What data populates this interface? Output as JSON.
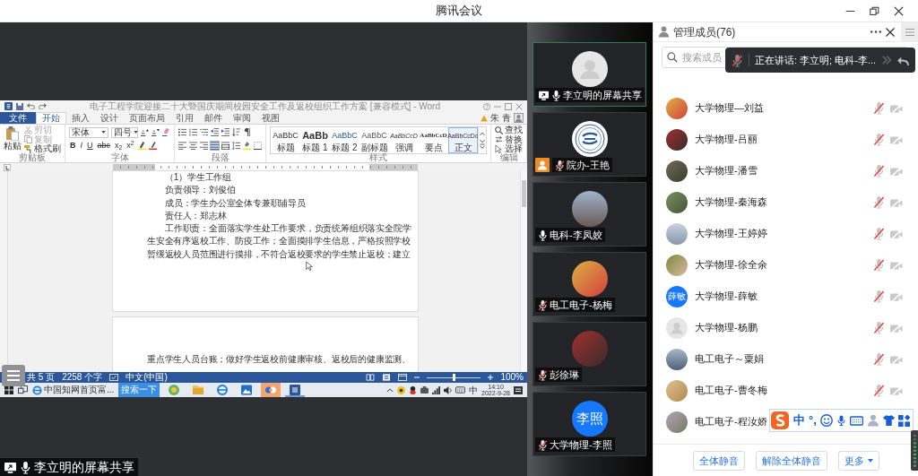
{
  "window": {
    "title": "腾讯会议"
  },
  "shared_screen": {
    "sharer": {
      "name": "李立明的屏幕共享",
      "muted": false
    },
    "word": {
      "title": "电子工程学院迎接二十大暨国庆期间校园安全工作及返校组织工作方案 [兼容模式] - Word",
      "tabs": [
        {
          "label": "文件",
          "kind": "file",
          "selected": false
        },
        {
          "label": "开始",
          "kind": "tab",
          "selected": true
        },
        {
          "label": "插入",
          "kind": "tab",
          "selected": false
        },
        {
          "label": "设计",
          "kind": "tab",
          "selected": false
        },
        {
          "label": "页面布局",
          "kind": "tab",
          "selected": false
        },
        {
          "label": "引用",
          "kind": "tab",
          "selected": false
        },
        {
          "label": "邮件",
          "kind": "tab",
          "selected": false
        },
        {
          "label": "审阅",
          "kind": "tab",
          "selected": false
        },
        {
          "label": "视图",
          "kind": "tab",
          "selected": false
        }
      ],
      "account": "朱 青",
      "ribbon": {
        "clipboard": {
          "paste": "粘贴",
          "items": [
            {
              "label": "剪切",
              "kind": "cut",
              "disabled": true
            },
            {
              "label": "复制",
              "kind": "copy",
              "disabled": true
            },
            {
              "label": "格式刷",
              "kind": "format_painter",
              "disabled": false
            }
          ],
          "label": "剪贴板"
        },
        "font": {
          "face": "宋体",
          "size": "四号",
          "format": [
            {
              "label": "B",
              "kind": "bold"
            },
            {
              "label": "I",
              "kind": "italic"
            },
            {
              "label": "U",
              "kind": "underline"
            },
            {
              "label": "abc",
              "kind": "strikethrough"
            },
            {
              "label": "x$_{2}$",
              "kind": "subscript"
            },
            {
              "label": "x$^{2}$",
              "kind": "superscript"
            }
          ],
          "label": "字体"
        },
        "paragraph": {
          "alignments": [
            {
              "kind": "left",
              "selected": false
            },
            {
              "kind": "center",
              "selected": false
            },
            {
              "kind": "right",
              "selected": false
            },
            {
              "kind": "justify",
              "selected": true
            },
            {
              "kind": "distributed",
              "selected": false
            }
          ],
          "label": "段落"
        },
        "styles": {
          "items": [
            {
              "sample": "AaBbC",
              "name": "标题",
              "kind": "title",
              "selected": false
            },
            {
              "sample": "AaBb",
              "name": "标题 1",
              "kind": "heading1",
              "selected": false
            },
            {
              "sample": "AaBbC",
              "name": "标题 2",
              "kind": "heading2",
              "selected": false
            },
            {
              "sample": "AaBbC",
              "name": "副标题",
              "kind": "subtitle",
              "selected": false
            },
            {
              "sample": "AaBbCcD",
              "name": "强调",
              "kind": "emphasis",
              "selected": false
            },
            {
              "sample": "AaBbCcD",
              "name": "要点",
              "kind": "strong",
              "selected": false
            },
            {
              "sample": "AaBbCcDd",
              "name": "正文",
              "kind": "normal",
              "selected": true
            }
          ],
          "label": "样式"
        },
        "editing": {
          "items": [
            {
              "label": "查找",
              "kind": "find"
            },
            {
              "label": "替换",
              "kind": "replace"
            },
            {
              "label": "选择",
              "kind": "select"
            }
          ],
          "label": "编辑"
        }
      },
      "pages": [
        {
          "lines": [
            {
              "text": "（1）学生工作组",
              "indent": true
            },
            {
              "text": "负责领导：刘俊伯",
              "indent": true
            },
            {
              "text": "成员：学生办公室全体专兼职辅导员",
              "indent": true
            },
            {
              "text": "责任人：郑志林",
              "indent": true
            },
            {
              "text": "工作职责：全面落实学生处工作要求，负责统筹组织落实全院学",
              "indent": true
            },
            {
              "text": "生安全有序返校工作、防疫工作；全面摸排学生信息，严格按照学校",
              "indent": false
            },
            {
              "text": "暂缓返校人员范围进行摸排，不符合返校要求的学生禁止返校；建立",
              "indent": false
            }
          ]
        },
        {
          "lines": [
            {
              "text": "重点学生人员台账；做好学生返校前健康审核、返校后的健康监测、",
              "indent": false
            }
          ]
        }
      ],
      "status_bar": {
        "pages": "共 5 页",
        "words": "2258 个字",
        "language": "中文(中国)",
        "zoom_slider": {
          "level": 0.5
        },
        "zoom": "100%"
      }
    },
    "taskbar": {
      "window": "中国知网首页富...",
      "search": "搜索一下",
      "apps": [
        {
          "kind": "browser",
          "active": false,
          "running": false
        },
        {
          "kind": "folder",
          "active": false,
          "running": false
        },
        {
          "kind": "ie",
          "active": false,
          "running": false
        },
        {
          "kind": "photos",
          "active": false,
          "running": false
        },
        {
          "kind": "meeting",
          "active": true,
          "running": false
        },
        {
          "kind": "word",
          "active": false,
          "running": true
        }
      ],
      "ime": "中",
      "time": "14:10",
      "date": "2022-9-28"
    }
  },
  "video_tiles": [
    {
      "name": "李立明的屏幕共享",
      "avatar": {
        "kind": "silhouette"
      },
      "speaking": true,
      "sharing": true,
      "host": false,
      "muted": false
    },
    {
      "name": "院办-王艳",
      "avatar": {
        "kind": "emblem"
      },
      "speaking": false,
      "sharing": false,
      "host": true,
      "muted": true
    },
    {
      "name": "电科-李凤姣",
      "avatar": {
        "kind": "photo"
      },
      "speaking": false,
      "sharing": false,
      "host": false,
      "muted": false
    },
    {
      "name": "电工电子-杨梅",
      "avatar": {
        "kind": "photo"
      },
      "speaking": false,
      "sharing": false,
      "host": false,
      "muted": true
    },
    {
      "name": "彭徐琳",
      "avatar": {
        "kind": "photo"
      },
      "speaking": false,
      "sharing": false,
      "host": false,
      "muted": true
    },
    {
      "name": "大学物理-李照",
      "avatar": {
        "kind": "initials",
        "text": "李照"
      },
      "speaking": false,
      "sharing": false,
      "host": false,
      "muted": true
    }
  ],
  "members": {
    "title": "管理成员(76)",
    "search": {
      "placeholder": "搜索成员"
    },
    "speaking_tip": "正在讲话: 李立明; 电科-李...",
    "rows": [
      {
        "name": "大学物理—刘益",
        "avatar": {
          "kind": "photo"
        },
        "mic_muted": true,
        "camera_off": true
      },
      {
        "name": "大学物理-吕丽",
        "avatar": {
          "kind": "photo"
        },
        "mic_muted": true,
        "camera_off": true
      },
      {
        "name": "大学物理-潘雪",
        "avatar": {
          "kind": "photo"
        },
        "mic_muted": true,
        "camera_off": true
      },
      {
        "name": "大学物理-秦海森",
        "avatar": {
          "kind": "photo"
        },
        "mic_muted": true,
        "camera_off": true
      },
      {
        "name": "大学物理-王婷婷",
        "avatar": {
          "kind": "photo"
        },
        "mic_muted": true,
        "camera_off": true
      },
      {
        "name": "大学物理-徐全余",
        "avatar": {
          "kind": "photo"
        },
        "mic_muted": true,
        "camera_off": true
      },
      {
        "name": "大学物理-薛敏",
        "avatar": {
          "kind": "initials",
          "text": "薛敏"
        },
        "mic_muted": true,
        "camera_off": true
      },
      {
        "name": "大学物理-杨鹏",
        "avatar": {
          "kind": "silhouette"
        },
        "mic_muted": true,
        "camera_off": true
      },
      {
        "name": "电工电子～粟娟",
        "avatar": {
          "kind": "photo"
        },
        "mic_muted": true,
        "camera_off": true
      },
      {
        "name": "电工电子-曹冬梅",
        "avatar": {
          "kind": "photo"
        },
        "mic_muted": true,
        "camera_off": true
      },
      {
        "name": "电工电子-程汝娇",
        "avatar": {
          "kind": "photo"
        }
      }
    ],
    "buttons": [
      {
        "label": "全体静音",
        "kind": "mute_all"
      },
      {
        "label": "解除全体静音",
        "kind": "unmute_all"
      },
      {
        "label": "更多",
        "kind": "more"
      }
    ]
  },
  "ime_toolbar": {
    "mode": "中",
    "punctuation": "°,"
  }
}
